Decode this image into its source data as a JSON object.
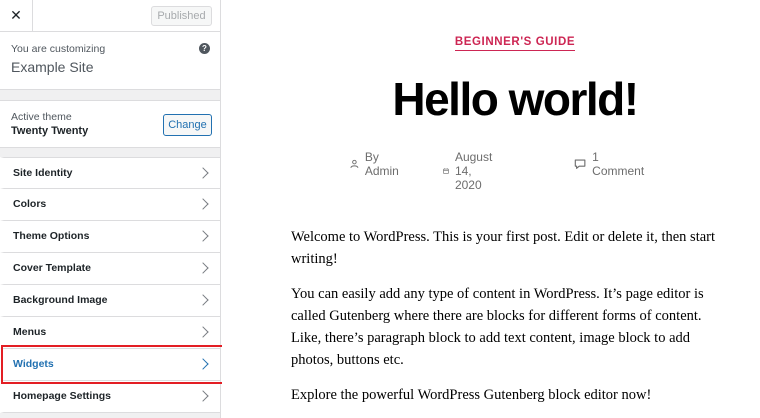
{
  "customizer": {
    "close_icon": "close-icon",
    "publish_label": "Published",
    "customizing_label": "You are customizing",
    "site_title": "Example Site",
    "help_icon": "help-icon",
    "active_theme_label": "Active theme",
    "theme_name": "Twenty Twenty",
    "change_label": "Change",
    "menu": [
      {
        "label": "Site Identity"
      },
      {
        "label": "Colors"
      },
      {
        "label": "Theme Options"
      },
      {
        "label": "Cover Template"
      },
      {
        "label": "Background Image"
      },
      {
        "label": "Menus"
      },
      {
        "label": "Widgets",
        "highlighted": true
      },
      {
        "label": "Homepage Settings"
      }
    ],
    "highlight_color": "#e31e24"
  },
  "preview": {
    "category": "BEGINNER'S GUIDE",
    "title": "Hello world!",
    "author": "By Admin",
    "date": "August 14, 2020",
    "comments": "1 Comment",
    "paragraphs": [
      "Welcome to WordPress. This is your first post. Edit or delete it, then start writing!",
      "You can easily add any type of content in WordPress. It’s page editor is called Gutenberg where there are blocks for different forms of content. Like, there’s paragraph block to add text content, image block to add photos, buttons etc.",
      "Explore the powerful WordPress Gutenberg block editor now!"
    ],
    "accent_color": "#cd2653"
  }
}
